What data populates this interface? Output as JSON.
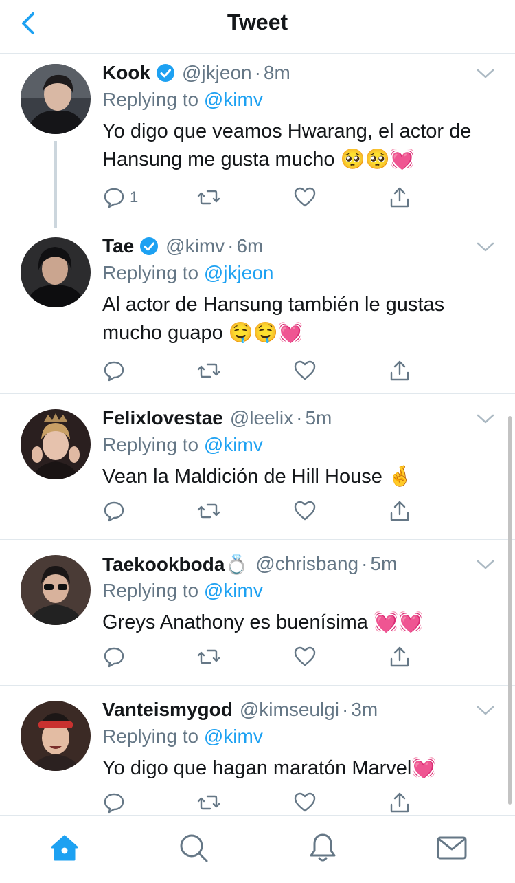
{
  "header": {
    "title": "Tweet",
    "back_icon": "chevron-left-icon"
  },
  "colors": {
    "accent": "#1da1f2",
    "text": "#14171a",
    "muted": "#657786",
    "divider": "#e1e8ed"
  },
  "tweets": [
    {
      "name": "Kook",
      "verified": true,
      "handle": "@jkjeon",
      "time": "8m",
      "reply_prefix": "Replying to",
      "reply_to": "@kimv",
      "text": "Yo digo que veamos Hwarang, el actor de Hansung me gusta mucho 🥺🥺💓",
      "reply_count": "1"
    },
    {
      "name": "Tae",
      "verified": true,
      "handle": "@kimv",
      "time": "6m",
      "reply_prefix": "Replying to",
      "reply_to": "@jkjeon",
      "text": "Al actor de Hansung también le gustas mucho guapo 🤤🤤💓",
      "reply_count": ""
    },
    {
      "name": "Felixlovestae",
      "verified": false,
      "handle": "@leelix",
      "time": "5m",
      "reply_prefix": "Replying to",
      "reply_to": "@kimv",
      "text": "Vean la Maldición de Hill House 🤞",
      "reply_count": ""
    },
    {
      "name": "Taekookboda💍",
      "verified": false,
      "handle": "@chrisbang",
      "time": "5m",
      "reply_prefix": "Replying to",
      "reply_to": "@kimv",
      "text": "Greys Anathony es buenísima 💓💓",
      "reply_count": ""
    },
    {
      "name": "Vanteismygod",
      "verified": false,
      "handle": "@kimseulgi",
      "time": "3m",
      "reply_prefix": "Replying to",
      "reply_to": "@kimv",
      "text": "Yo digo que hagan maratón Marvel💓",
      "reply_count": ""
    }
  ],
  "tabbar": {
    "items": [
      {
        "icon": "home-icon",
        "active": true
      },
      {
        "icon": "search-icon",
        "active": false
      },
      {
        "icon": "notifications-icon",
        "active": false
      },
      {
        "icon": "messages-icon",
        "active": false
      }
    ]
  }
}
